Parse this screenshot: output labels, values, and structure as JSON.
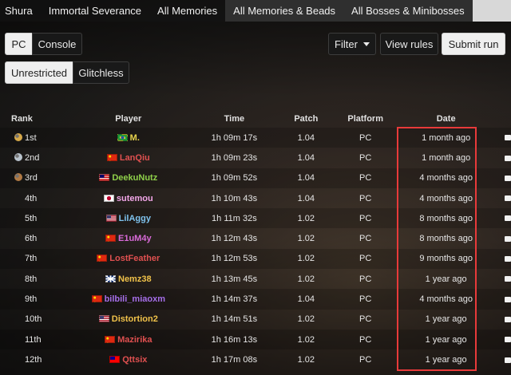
{
  "tabs": [
    {
      "label": "Shura",
      "active": false
    },
    {
      "label": "Immortal Severance",
      "active": false
    },
    {
      "label": "All Memories",
      "active": false
    },
    {
      "label": "All Memories & Beads",
      "active": true
    },
    {
      "label": "All Bosses & Minibosses",
      "active": false
    }
  ],
  "platform_toggle": {
    "pc": "PC",
    "console": "Console",
    "selected": "PC"
  },
  "toolbar": {
    "filter": "Filter",
    "view_rules": "View rules",
    "submit_run": "Submit run"
  },
  "category_toggle": {
    "unrestricted": "Unrestricted",
    "glitchless": "Glitchless",
    "selected": "Unrestricted"
  },
  "columns": {
    "rank": "Rank",
    "player": "Player",
    "time": "Time",
    "patch": "Patch",
    "platform": "Platform",
    "date": "Date"
  },
  "colors": {
    "gold": "#d6a84a",
    "silver": "#b9c3cc",
    "bronze": "#b07a45",
    "highlight": "#e83a3a"
  },
  "rows": [
    {
      "rank": "1st",
      "medal": "gold",
      "flag": "brazil",
      "player": "M.",
      "color": "#e8d44d",
      "time": "1h 09m 17s",
      "patch": "1.04",
      "platform": "PC",
      "date": "1 month ago"
    },
    {
      "rank": "2nd",
      "medal": "silver",
      "flag": "china",
      "player": "LanQiu",
      "color": "#e05050",
      "time": "1h 09m 23s",
      "patch": "1.04",
      "platform": "PC",
      "date": "1 month ago"
    },
    {
      "rank": "3rd",
      "medal": "bronze",
      "flag": "malaysia",
      "player": "DeekuNutz",
      "color": "#8fd04a",
      "time": "1h 09m 52s",
      "patch": "1.04",
      "platform": "PC",
      "date": "4 months ago"
    },
    {
      "rank": "4th",
      "medal": "",
      "flag": "japan",
      "player": "sutemou",
      "color": "#f2a6e8",
      "time": "1h 10m 43s",
      "patch": "1.04",
      "platform": "PC",
      "date": "4 months ago"
    },
    {
      "rank": "5th",
      "medal": "",
      "flag": "usa",
      "player": "LilAggy",
      "color": "#7fc3ee",
      "time": "1h 11m 32s",
      "patch": "1.02",
      "platform": "PC",
      "date": "8 months ago"
    },
    {
      "rank": "6th",
      "medal": "",
      "flag": "china",
      "player": "E1uM4y",
      "color": "#d96ad9",
      "time": "1h 12m 43s",
      "patch": "1.02",
      "platform": "PC",
      "date": "8 months ago"
    },
    {
      "rank": "7th",
      "medal": "",
      "flag": "china",
      "player": "LostFeather",
      "color": "#e05050",
      "time": "1h 12m 53s",
      "patch": "1.02",
      "platform": "PC",
      "date": "9 months ago"
    },
    {
      "rank": "8th",
      "medal": "",
      "flag": "uk",
      "player": "Nemz38",
      "color": "#f0c24a",
      "time": "1h 13m 45s",
      "patch": "1.02",
      "platform": "PC",
      "date": "1 year ago"
    },
    {
      "rank": "9th",
      "medal": "",
      "flag": "china",
      "player": "bilbili_miaoxm",
      "color": "#a56ee8",
      "time": "1h 14m 37s",
      "patch": "1.04",
      "platform": "PC",
      "date": "4 months ago"
    },
    {
      "rank": "10th",
      "medal": "",
      "flag": "usa",
      "player": "Distortion2",
      "color": "#f0c24a",
      "time": "1h 14m 51s",
      "patch": "1.02",
      "platform": "PC",
      "date": "1 year ago"
    },
    {
      "rank": "11th",
      "medal": "",
      "flag": "china",
      "player": "Mazirika",
      "color": "#e05050",
      "time": "1h 16m 13s",
      "patch": "1.02",
      "platform": "PC",
      "date": "1 year ago"
    },
    {
      "rank": "12th",
      "medal": "",
      "flag": "taiwan",
      "player": "Qttsix",
      "color": "#e05050",
      "time": "1h 17m 08s",
      "patch": "1.02",
      "platform": "PC",
      "date": "1 year ago"
    }
  ]
}
